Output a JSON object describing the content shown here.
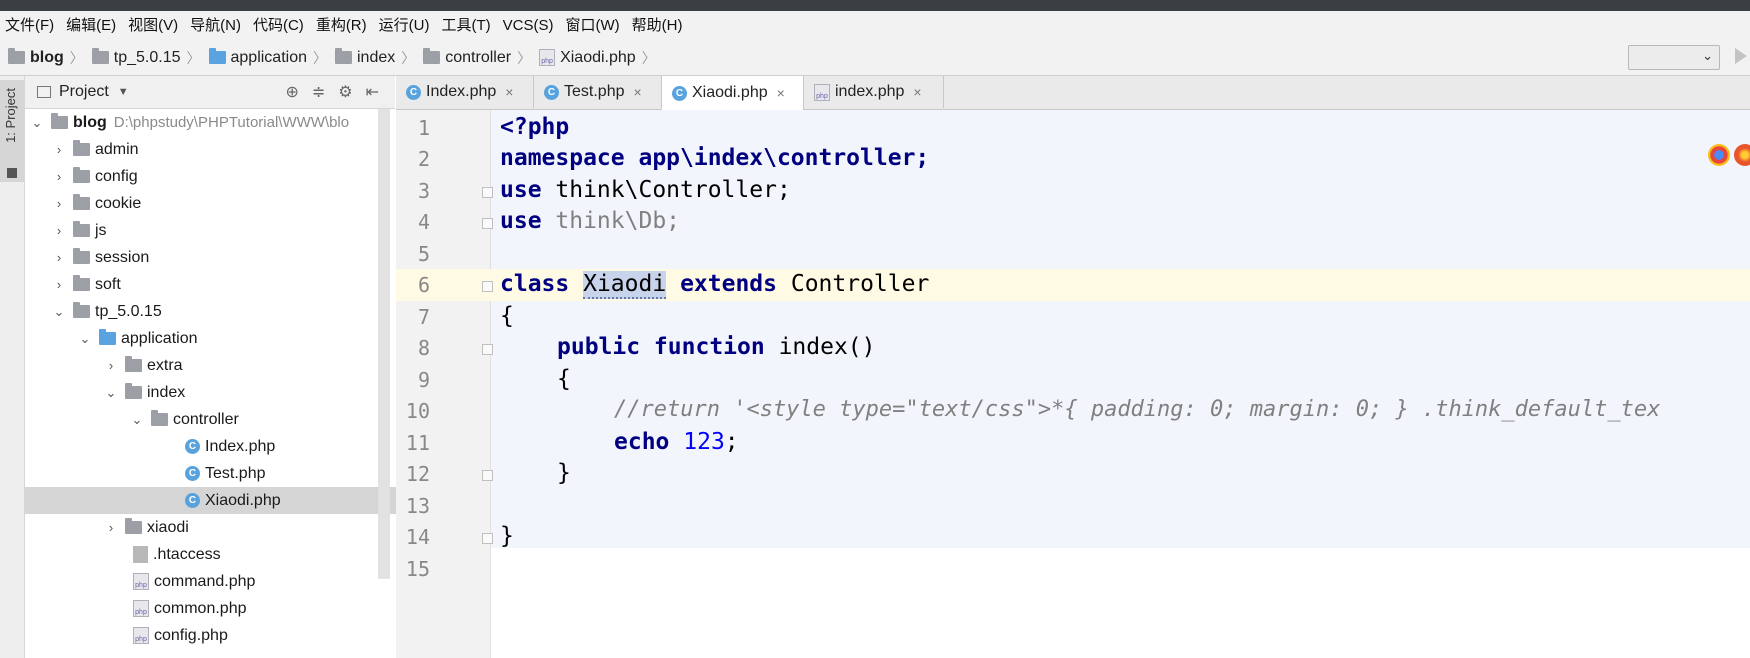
{
  "menu": [
    "文件(F)",
    "编辑(E)",
    "视图(V)",
    "导航(N)",
    "代码(C)",
    "重构(R)",
    "运行(U)",
    "工具(T)",
    "VCS(S)",
    "窗口(W)",
    "帮助(H)"
  ],
  "breadcrumb": [
    "blog",
    "tp_5.0.15",
    "application",
    "index",
    "controller",
    "Xiaodi.php"
  ],
  "project_panel": {
    "side_tab": "1: Project",
    "title": "Project",
    "tree": [
      {
        "label": "blog",
        "path": "D:\\phpstudy\\PHPTutorial\\WWW\\blo"
      },
      {
        "label": "admin"
      },
      {
        "label": "config"
      },
      {
        "label": "cookie"
      },
      {
        "label": "js"
      },
      {
        "label": "session"
      },
      {
        "label": "soft"
      },
      {
        "label": "tp_5.0.15"
      },
      {
        "label": "application"
      },
      {
        "label": "extra"
      },
      {
        "label": "index"
      },
      {
        "label": "controller"
      },
      {
        "label": "Index.php"
      },
      {
        "label": "Test.php"
      },
      {
        "label": "Xiaodi.php"
      },
      {
        "label": "xiaodi"
      },
      {
        "label": ".htaccess"
      },
      {
        "label": "command.php"
      },
      {
        "label": "common.php"
      },
      {
        "label": "config.php"
      }
    ]
  },
  "tabs": [
    {
      "label": "Index.php"
    },
    {
      "label": "Test.php"
    },
    {
      "label": "Xiaodi.php",
      "active": true
    },
    {
      "label": "index.php"
    }
  ],
  "editor": {
    "line_numbers": [
      "1",
      "2",
      "3",
      "4",
      "5",
      "6",
      "7",
      "8",
      "9",
      "10",
      "11",
      "12",
      "13",
      "14",
      "15"
    ],
    "code": {
      "l1": "<?php",
      "l2": "namespace app\\index\\controller;",
      "l3_kw": "use",
      "l3_rest": " think\\Controller;",
      "l4_kw": "use",
      "l4_rest": " think\\Db;",
      "l6_kw": "class",
      "l6_name": "Xiaodi",
      "l6_ext": "extends",
      "l6_rest": " Controller",
      "l7": "{",
      "l8_kw": "public function",
      "l8_rest": " index()",
      "l9": "{",
      "l10": "//return '<style type=\"text/css\">*{ padding: 0; margin: 0; } .think_default_tex",
      "l11_kw": "echo",
      "l11_num": "123",
      "l11_end": ";",
      "l12": "}",
      "l14": "}"
    }
  },
  "colors": {
    "keyword": "#000080",
    "number": "#0000ff",
    "comment": "#808080",
    "caret_line": "#fffae3",
    "selection": "#d5d5d5"
  }
}
